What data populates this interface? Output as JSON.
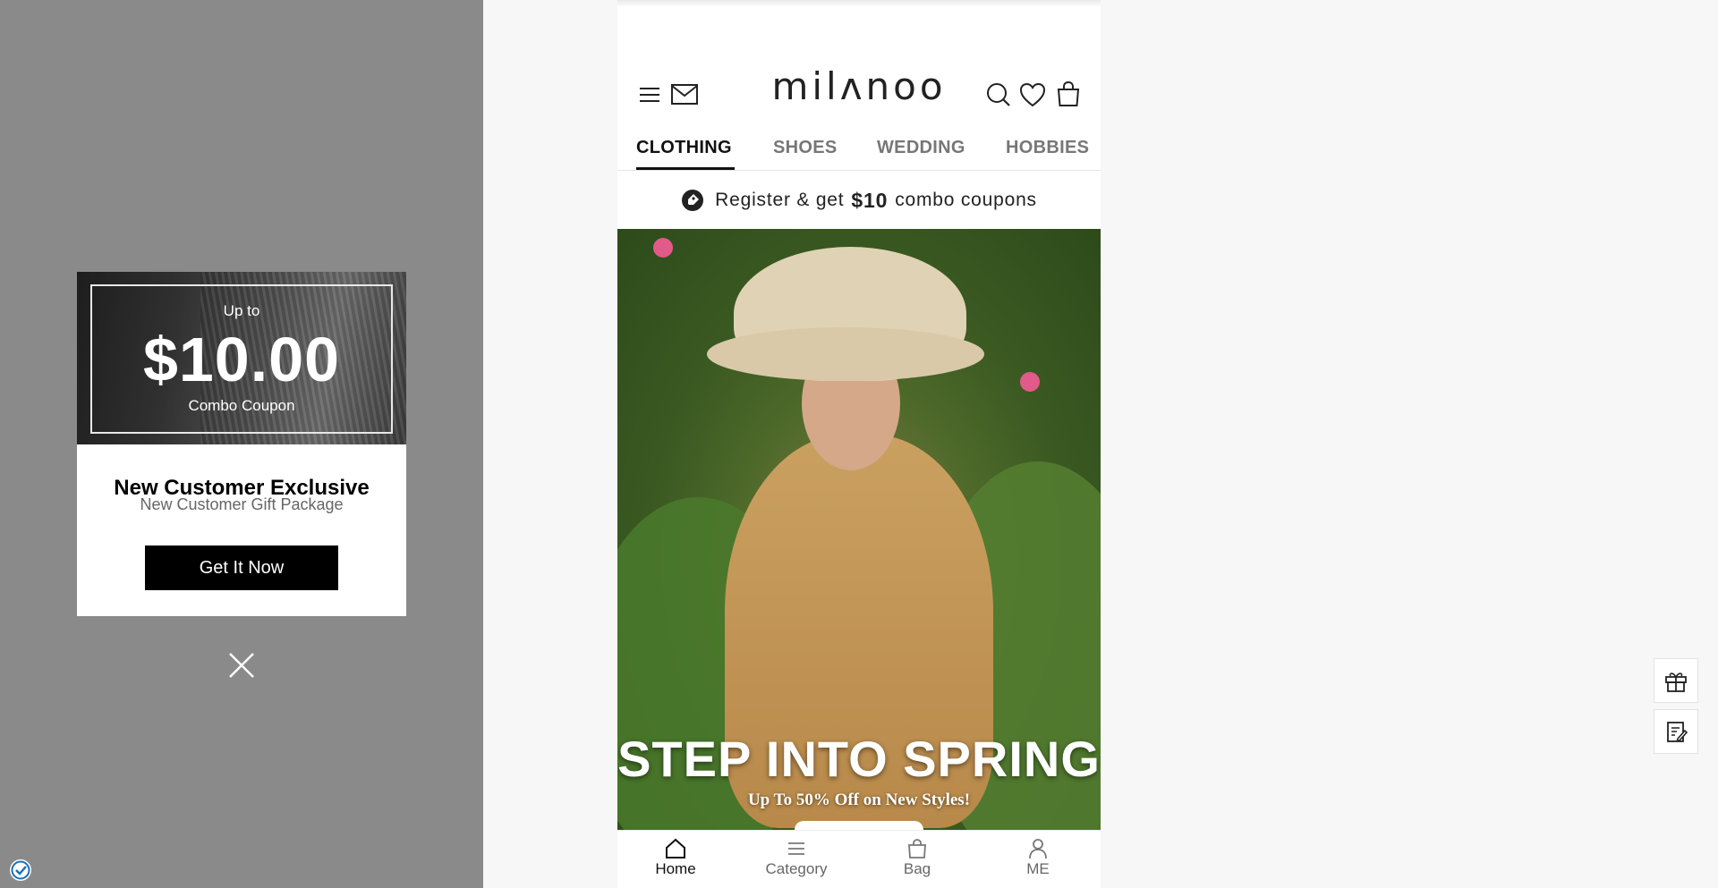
{
  "popup": {
    "up_to": "Up to",
    "amount": "$10.00",
    "combo": "Combo Coupon",
    "title": "New Customer Exclusive",
    "subtitle": "New Customer Gift Package",
    "cta": "Get It Now",
    "close_icon": "close-icon",
    "badge_icon": "verified-check-icon"
  },
  "header": {
    "logo": "milʌnoo",
    "icons": [
      "menu-icon",
      "mail-icon",
      "search-icon",
      "heart-icon",
      "bag-icon"
    ]
  },
  "tabs": [
    {
      "label": "CLOTHING",
      "active": true
    },
    {
      "label": "SHOES",
      "active": false
    },
    {
      "label": "WEDDING",
      "active": false
    },
    {
      "label": "HOBBIES",
      "active": false
    }
  ],
  "register_banner": {
    "prefix": "Register & get",
    "amount": "$10",
    "suffix": "combo coupons",
    "icon": "coupon-tag-icon"
  },
  "hero": {
    "title": "STEP INTO SPRING",
    "subtitle": "Up To 50% Off on New Styles!"
  },
  "bottom_nav": [
    {
      "label": "Home",
      "icon": "home-icon",
      "active": true
    },
    {
      "label": "Category",
      "icon": "category-icon",
      "active": false
    },
    {
      "label": "Bag",
      "icon": "bag-icon",
      "active": false
    },
    {
      "label": "ME",
      "icon": "user-icon",
      "active": false
    }
  ],
  "floating": [
    "gift-icon",
    "survey-icon"
  ],
  "colors": {
    "overlay": "#8a8a8a",
    "cta_bg": "#000000",
    "page_bg": "#f7f7f7"
  }
}
